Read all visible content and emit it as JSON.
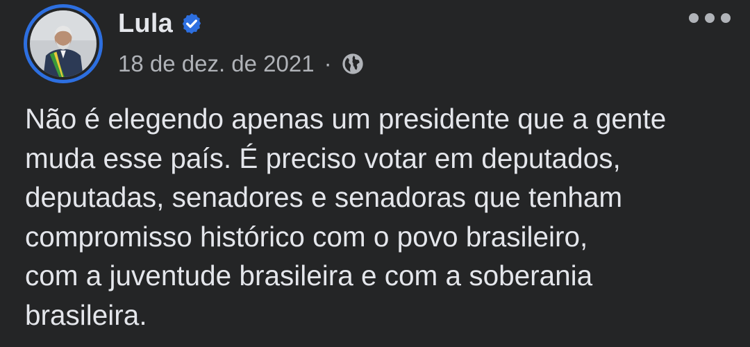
{
  "post": {
    "author": "Lula",
    "date": "18 de dez. de 2021",
    "separator": "·",
    "text": "Não é elegendo apenas um presidente que a gente\nmuda esse país. É preciso votar em deputados,\ndeputadas, senadores e senadoras que tenham\ncompromisso histórico com o povo brasileiro,\ncom a juventude brasileira e com a soberania\nbrasileira."
  },
  "icons": {
    "verified": "verified-badge-icon",
    "privacy": "globe-icon",
    "menu": "more-options-icon"
  },
  "colors": {
    "background": "#242526",
    "primary_text": "#e4e6eb",
    "secondary_text": "#b0b3b8",
    "accent": "#2d6fe0"
  }
}
